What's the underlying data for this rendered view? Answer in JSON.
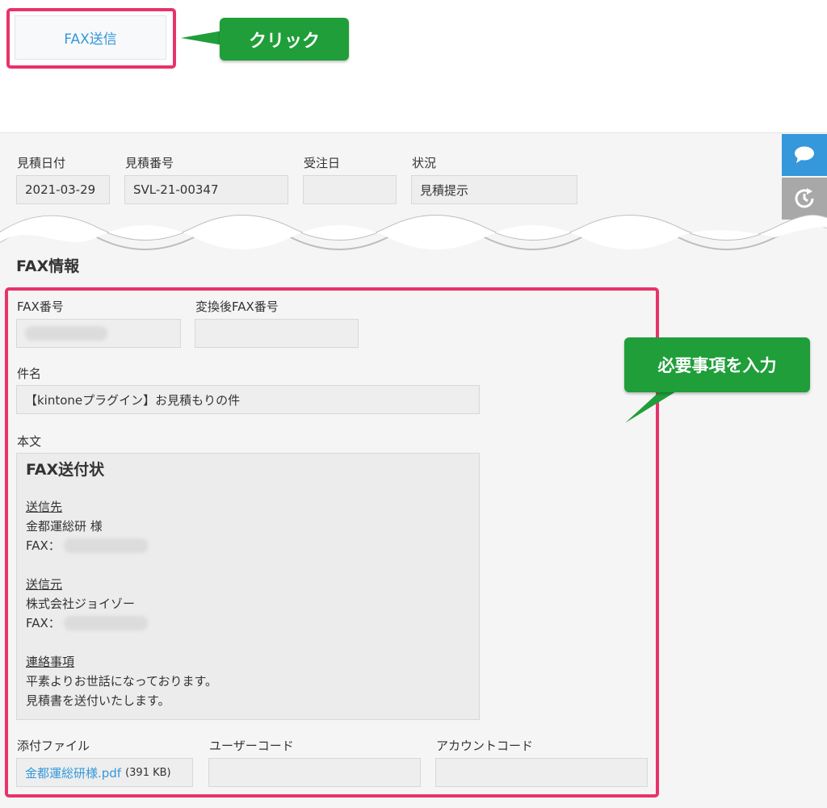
{
  "toolbar": {
    "fax_button_label": "FAX送信"
  },
  "callouts": {
    "click": "クリック",
    "fill_in": "必要事項を入力"
  },
  "header_fields": {
    "estimate_date": {
      "label": "見積日付",
      "value": "2021-03-29"
    },
    "estimate_number": {
      "label": "見積番号",
      "value": "SVL-21-00347"
    },
    "order_date": {
      "label": "受注日",
      "value": ""
    },
    "status": {
      "label": "状況",
      "value": "見積提示"
    }
  },
  "fax_section": {
    "title": "FAX情報",
    "fax_number": {
      "label": "FAX番号",
      "value": ""
    },
    "converted_fax_number": {
      "label": "変換後FAX番号",
      "value": ""
    },
    "subject": {
      "label": "件名",
      "value": "【kintoneプラグイン】お見積もりの件"
    },
    "body": {
      "label": "本文",
      "heading": "FAX送付状",
      "to_label": "送信先",
      "to_name": "金都運総研 様",
      "to_fax": "FAX：",
      "from_label": "送信元",
      "from_name": "株式会社ジョイゾー",
      "from_fax": "FAX：",
      "notes_label": "連絡事項",
      "notes_line1": "平素よりお世話になっております。",
      "notes_line2": "見積書を送付いたします。"
    },
    "attachment": {
      "label": "添付ファイル",
      "file_name": "金都運総研様.pdf",
      "file_size": "(391 KB)"
    },
    "user_code": {
      "label": "ユーザーコード",
      "value": ""
    },
    "account_code": {
      "label": "アカウントコード",
      "value": ""
    }
  },
  "colors": {
    "accent_blue": "#3498db",
    "highlight_pink": "#e8336a",
    "callout_green": "#1f9e3a"
  },
  "icons": {
    "comment": "comment-icon",
    "history": "history-icon"
  }
}
